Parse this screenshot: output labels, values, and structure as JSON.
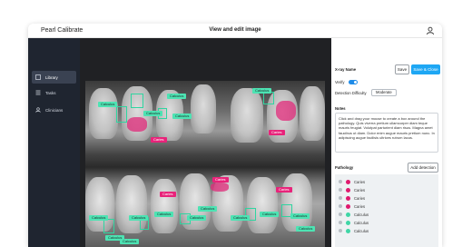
{
  "app": {
    "title": "Pearl Calibrate",
    "page_title": "View and edit image"
  },
  "sidebar": {
    "items": [
      {
        "label": "Library",
        "icon": "library-icon",
        "active": true
      },
      {
        "label": "Tasks",
        "icon": "tasks-icon",
        "active": false
      },
      {
        "label": "Clinicians",
        "icon": "clinicians-icon",
        "active": false
      }
    ]
  },
  "viewer": {
    "tags": [
      {
        "label": "Calculus",
        "type": "calculus"
      },
      {
        "label": "Calculus",
        "type": "calculus"
      },
      {
        "label": "Calculus",
        "type": "calculus"
      },
      {
        "label": "Calculus",
        "type": "calculus"
      },
      {
        "label": "Caries",
        "type": "caries"
      },
      {
        "label": "Caries",
        "type": "caries"
      },
      {
        "label": "Calculus",
        "type": "calculus"
      },
      {
        "label": "Caries",
        "type": "caries"
      },
      {
        "label": "Caries",
        "type": "caries"
      },
      {
        "label": "Caries",
        "type": "caries"
      },
      {
        "label": "Calculus",
        "type": "calculus"
      },
      {
        "label": "Calculus",
        "type": "calculus"
      },
      {
        "label": "Calculus",
        "type": "calculus"
      },
      {
        "label": "Calculus",
        "type": "calculus"
      },
      {
        "label": "Calculus",
        "type": "calculus"
      },
      {
        "label": "Calculus",
        "type": "calculus"
      },
      {
        "label": "Calculus",
        "type": "calculus"
      },
      {
        "label": "Calculus",
        "type": "calculus"
      },
      {
        "label": "Calculus",
        "type": "calculus"
      },
      {
        "label": "Calculus",
        "type": "calculus"
      },
      {
        "label": "Calculus",
        "type": "calculus"
      }
    ]
  },
  "panel": {
    "xray_name_label": "X-ray Name",
    "save_label": "Save",
    "save_close_label": "Save & Close",
    "verify_label": "Verify",
    "verify_on": true,
    "difficulty_label": "Detection Difficulty",
    "difficulty_value": "Moderate",
    "notes_label": "Notes",
    "notes_text": "Click and drag your mouse to create a box around the pathology. Quis viverra pretium ullamcorper diam teque mauris feugiat. Volutpat parturient diam risus. Magna amet faucibus ut diam. Dolor enim augue mauris pretium nunc. In adipiscing augue facilisis ultrices rutrum lacus.",
    "pathology_label": "Pathology",
    "add_detection_label": "Add detection",
    "pathology_items": [
      {
        "label": "Caries",
        "color": "#e0196e"
      },
      {
        "label": "Caries",
        "color": "#e0196e"
      },
      {
        "label": "Caries",
        "color": "#e0196e"
      },
      {
        "label": "Caries",
        "color": "#e0196e"
      },
      {
        "label": "Calculus",
        "color": "#3fd6a6"
      },
      {
        "label": "Calculus",
        "color": "#3fd6a6"
      },
      {
        "label": "Calculus",
        "color": "#3fd6a6"
      }
    ]
  },
  "colors": {
    "accent": "#1ea7f4",
    "sidebar": "#1f2530",
    "caries": "#e8237a",
    "calculus": "#4de3b3"
  }
}
